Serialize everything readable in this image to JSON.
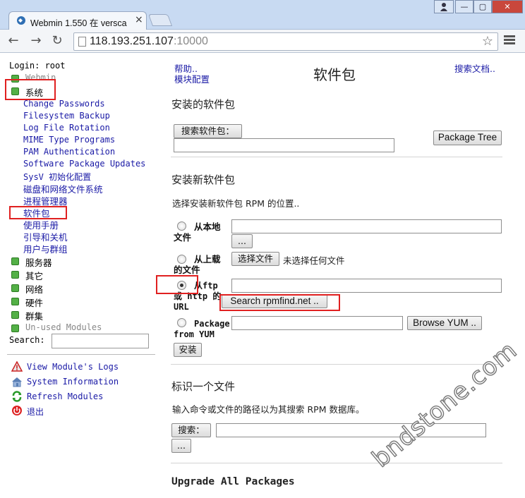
{
  "browser": {
    "tab_title": "Webmin 1.550 在 versca",
    "url_host": "118.193.251.107",
    "url_port": ":10000",
    "window_controls": [
      "user-icon",
      "minimize-icon",
      "maximize-icon",
      "close-icon"
    ]
  },
  "left": {
    "login": "Login: root",
    "webmin": "Webmin",
    "system": "系统",
    "system_modules": [
      "Change Passwords",
      "Filesystem Backup",
      "Log File Rotation",
      "MIME Type Programs",
      "PAM Authentication",
      "Software Package Updates",
      "SysV 初始化配置",
      "磁盘和网络文件系统",
      "进程管理器",
      "软件包",
      "使用手册",
      "引导和关机",
      "用户与群组"
    ],
    "categories": [
      "服务器",
      "其它",
      "网络",
      "硬件",
      "群集"
    ],
    "unused": "Un-used Modules",
    "search_label": "Search:",
    "utilities": [
      "View Module's Logs",
      "System Information",
      "Refresh Modules",
      "退出"
    ]
  },
  "right": {
    "help": "帮助..",
    "module_config": "模块配置",
    "title": "软件包",
    "search_docs": "搜索文档..",
    "installed": {
      "heading": "安装的软件包",
      "search_button": "搜索软件包：",
      "package_tree": "Package Tree"
    },
    "install_new": {
      "heading": "安装新软件包",
      "description": "选择安装新软件包 RPM 的位置..",
      "local_label": "从本地文件",
      "browse_small": "...",
      "upload_label": "从上载的文件",
      "choose_file": "选择文件",
      "no_file": "未选择任何文件",
      "ftp_label": "从ftp 或 http 的 URL",
      "search_rpmfind": "Search rpmfind.net ..",
      "yum_label": "Package from YUM",
      "browse_yum": "Browse YUM ..",
      "install_button": "安装"
    },
    "identify": {
      "heading": "标识一个文件",
      "description": "输入命令或文件的路径以为其搜索 RPM 数据库。",
      "search_button": "搜索：",
      "browse_small": "..."
    },
    "upgrade_heading": "Upgrade All Packages"
  },
  "watermark": "bndstone.com",
  "colors": {
    "link": "#1a1aa6",
    "highlight": "#e02020",
    "category_box": "#53b046"
  }
}
